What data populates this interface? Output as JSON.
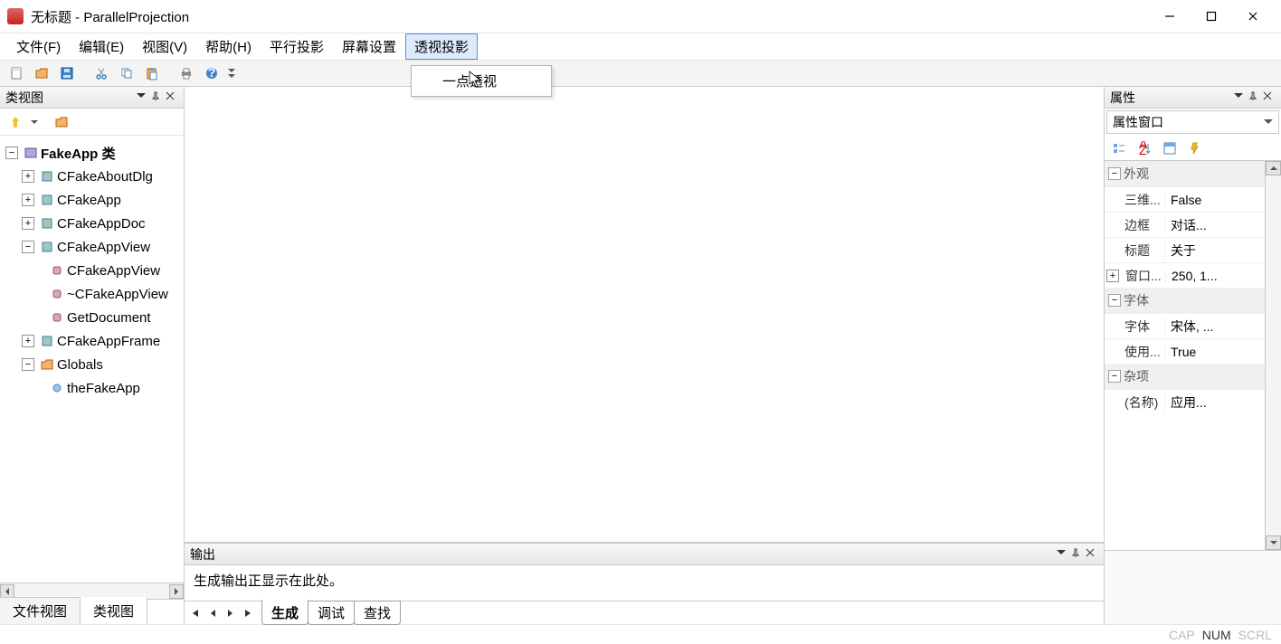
{
  "titlebar": {
    "title": "无标题 - ParallelProjection"
  },
  "menu": {
    "file": "文件(F)",
    "edit": "编辑(E)",
    "view": "视图(V)",
    "help": "帮助(H)",
    "parallel": "平行投影",
    "screen": "屏幕设置",
    "perspective": "透视投影"
  },
  "dropdown": {
    "item1": "一点透视"
  },
  "classview": {
    "title": "类视图",
    "root": "FakeApp 类",
    "nodes": {
      "n0": "CFakeAboutDlg",
      "n1": "CFakeApp",
      "n2": "CFakeAppDoc",
      "n3": "CFakeAppView",
      "n3_0": "CFakeAppView",
      "n3_1": "~CFakeAppView",
      "n3_2": "GetDocument",
      "n4": "CFakeAppFrame",
      "n5": "Globals",
      "n5_0": "theFakeApp"
    },
    "tab_file": "文件视图",
    "tab_class": "类视图"
  },
  "props": {
    "title": "属性",
    "combo": "属性窗口",
    "cat_appearance": "外观",
    "rows": {
      "threed_k": "三维...",
      "threed_v": "False",
      "border_k": "边框",
      "border_v": "对话...",
      "caption_k": "标题",
      "caption_v": "关于",
      "window_k": "窗口...",
      "window_v": "250, 1..."
    },
    "cat_font": "字体",
    "rows_font": {
      "font_k": "字体",
      "font_v": "宋体, ...",
      "use_k": "使用...",
      "use_v": "True"
    },
    "cat_misc": "杂项",
    "rows_misc": {
      "name_k": "(名称)",
      "name_v": "应用..."
    }
  },
  "output": {
    "title": "输出",
    "body": "生成输出正显示在此处。",
    "tab_build": "生成",
    "tab_debug": "调试",
    "tab_find": "查找"
  },
  "status": {
    "cap": "CAP",
    "num": "NUM",
    "scrl": "SCRL"
  }
}
